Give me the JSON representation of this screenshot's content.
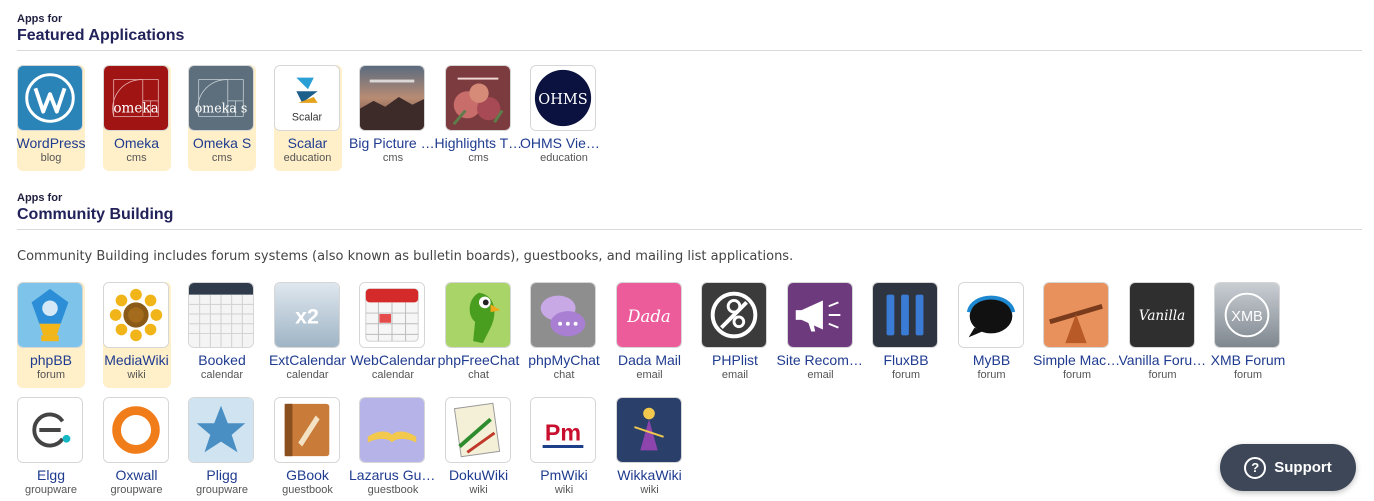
{
  "featured": {
    "kicker": "Apps for",
    "title": "Featured Applications",
    "apps": [
      {
        "name": "WordPress",
        "category": "blog",
        "highlight": true,
        "icon": "wordpress-icon"
      },
      {
        "name": "Omeka",
        "category": "cms",
        "highlight": true,
        "icon": "omeka-icon"
      },
      {
        "name": "Omeka S",
        "category": "cms",
        "highlight": true,
        "icon": "omeka-s-icon"
      },
      {
        "name": "Scalar",
        "category": "education",
        "highlight": true,
        "icon": "scalar-icon"
      },
      {
        "name": "Big Picture Calling Card",
        "category": "cms",
        "highlight": false,
        "icon": "big-picture-icon"
      },
      {
        "name": "Highlights Theme",
        "category": "cms",
        "highlight": false,
        "icon": "highlights-icon"
      },
      {
        "name": "OHMS Viewer",
        "category": "education",
        "highlight": false,
        "icon": "ohms-icon"
      }
    ],
    "icon_text": {
      "omeka": "omeka",
      "omeka_s": "omeka s",
      "scalar": "Scalar",
      "ohms": "OHMS"
    }
  },
  "community": {
    "kicker": "Apps for",
    "title": "Community Building",
    "description": "Community Building includes forum systems (also known as bulletin boards), guestbooks, and mailing list applications.",
    "apps": [
      {
        "name": "phpBB",
        "category": "forum",
        "highlight": true,
        "icon": "phpbb-icon"
      },
      {
        "name": "MediaWiki",
        "category": "wiki",
        "highlight": true,
        "icon": "mediawiki-icon"
      },
      {
        "name": "Booked",
        "category": "calendar",
        "highlight": false,
        "icon": "booked-icon"
      },
      {
        "name": "ExtCalendar",
        "category": "calendar",
        "highlight": false,
        "icon": "extcalendar-icon"
      },
      {
        "name": "WebCalendar",
        "category": "calendar",
        "highlight": false,
        "icon": "webcalendar-icon"
      },
      {
        "name": "phpFreeChat",
        "category": "chat",
        "highlight": false,
        "icon": "phpfreechat-icon"
      },
      {
        "name": "phpMyChat",
        "category": "chat",
        "highlight": false,
        "icon": "phpmychat-icon"
      },
      {
        "name": "Dada Mail",
        "category": "email",
        "highlight": false,
        "icon": "dada-mail-icon"
      },
      {
        "name": "PHPlist",
        "category": "email",
        "highlight": false,
        "icon": "phplist-icon"
      },
      {
        "name": "Site Recommender",
        "category": "email",
        "highlight": false,
        "icon": "site-recommender-icon"
      },
      {
        "name": "FluxBB",
        "category": "forum",
        "highlight": false,
        "icon": "fluxbb-icon"
      },
      {
        "name": "MyBB",
        "category": "forum",
        "highlight": false,
        "icon": "mybb-icon"
      },
      {
        "name": "Simple Machines Forum",
        "category": "forum",
        "highlight": false,
        "icon": "simple-machines-icon"
      },
      {
        "name": "Vanilla Forums",
        "category": "forum",
        "highlight": false,
        "icon": "vanilla-icon"
      },
      {
        "name": "XMB Forum",
        "category": "forum",
        "highlight": false,
        "icon": "xmb-icon"
      },
      {
        "name": "Elgg",
        "category": "groupware",
        "highlight": false,
        "icon": "elgg-icon"
      },
      {
        "name": "Oxwall",
        "category": "groupware",
        "highlight": false,
        "icon": "oxwall-icon"
      },
      {
        "name": "Pligg",
        "category": "groupware",
        "highlight": false,
        "icon": "pligg-icon"
      },
      {
        "name": "GBook",
        "category": "guestbook",
        "highlight": false,
        "icon": "gbook-icon"
      },
      {
        "name": "Lazarus Guestbook",
        "category": "guestbook",
        "highlight": false,
        "icon": "lazarus-icon"
      },
      {
        "name": "DokuWiki",
        "category": "wiki",
        "highlight": false,
        "icon": "dokuwiki-icon"
      },
      {
        "name": "PmWiki",
        "category": "wiki",
        "highlight": false,
        "icon": "pmwiki-icon"
      },
      {
        "name": "WikkaWiki",
        "category": "wiki",
        "highlight": false,
        "icon": "wikkawiki-icon"
      }
    ],
    "icon_text": {
      "extcalendar": "x2",
      "dada": "Dada",
      "vanilla": "Vanilla",
      "xmb": "XMB",
      "pm": "Pm"
    }
  },
  "support": {
    "label": "Support",
    "icon": "question-circle-icon"
  },
  "colors": {
    "link": "#1f3b8f",
    "heading": "#22225a",
    "highlight": "#fff0c9",
    "support_bg": "#3e4758"
  }
}
